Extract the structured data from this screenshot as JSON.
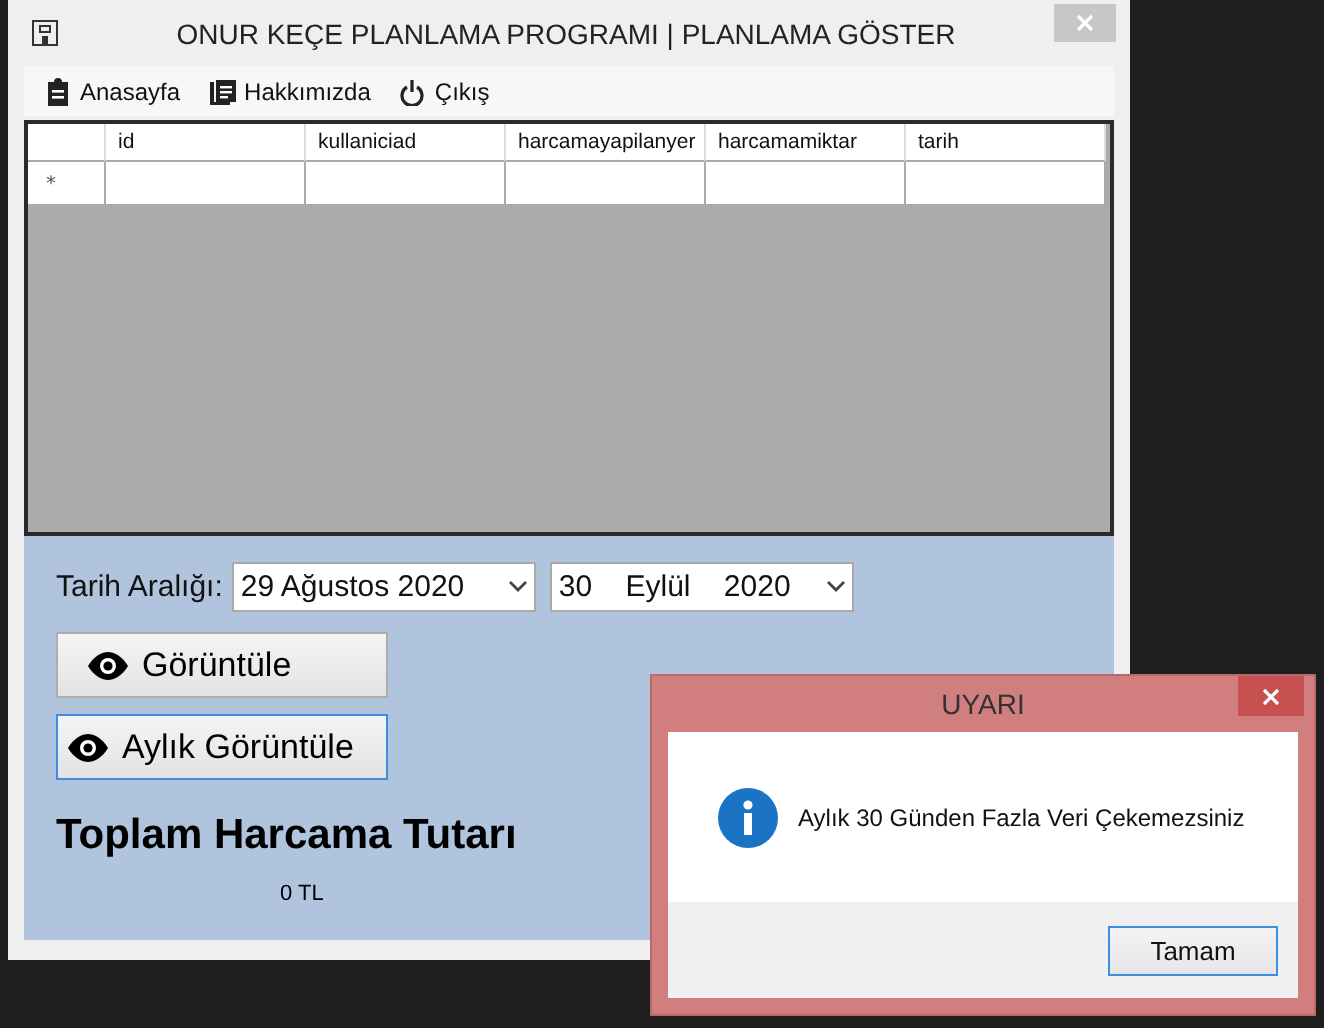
{
  "window": {
    "title": "ONUR KEÇE PLANLAMA PROGRAMI | PLANLAMA GÖSTER"
  },
  "menu": [
    {
      "label": "Anasayfa",
      "kind": "clipboard"
    },
    {
      "label": "Hakkımızda",
      "kind": "document"
    },
    {
      "label": "Çıkış",
      "kind": "power"
    }
  ],
  "grid": {
    "columns": [
      "id",
      "kullaniciad",
      "harcamayapilanyer",
      "harcamamiktar",
      "tarih"
    ],
    "new_row_marker": "*"
  },
  "date_range": {
    "label": "Tarih Aralığı:",
    "start": "29 Ağustos 2020",
    "end": "30    Eylül    2020"
  },
  "buttons": [
    {
      "label": "Görüntüle",
      "focused": false
    },
    {
      "label": "Aylık Görüntüle",
      "focused": true
    }
  ],
  "total": {
    "label": "Toplam Harcama Tutarı",
    "value": "0 TL"
  },
  "dialog": {
    "title": "UYARI",
    "message": "Aylık 30 Günden Fazla Veri Çekemezsiniz",
    "button": "Tamam"
  }
}
